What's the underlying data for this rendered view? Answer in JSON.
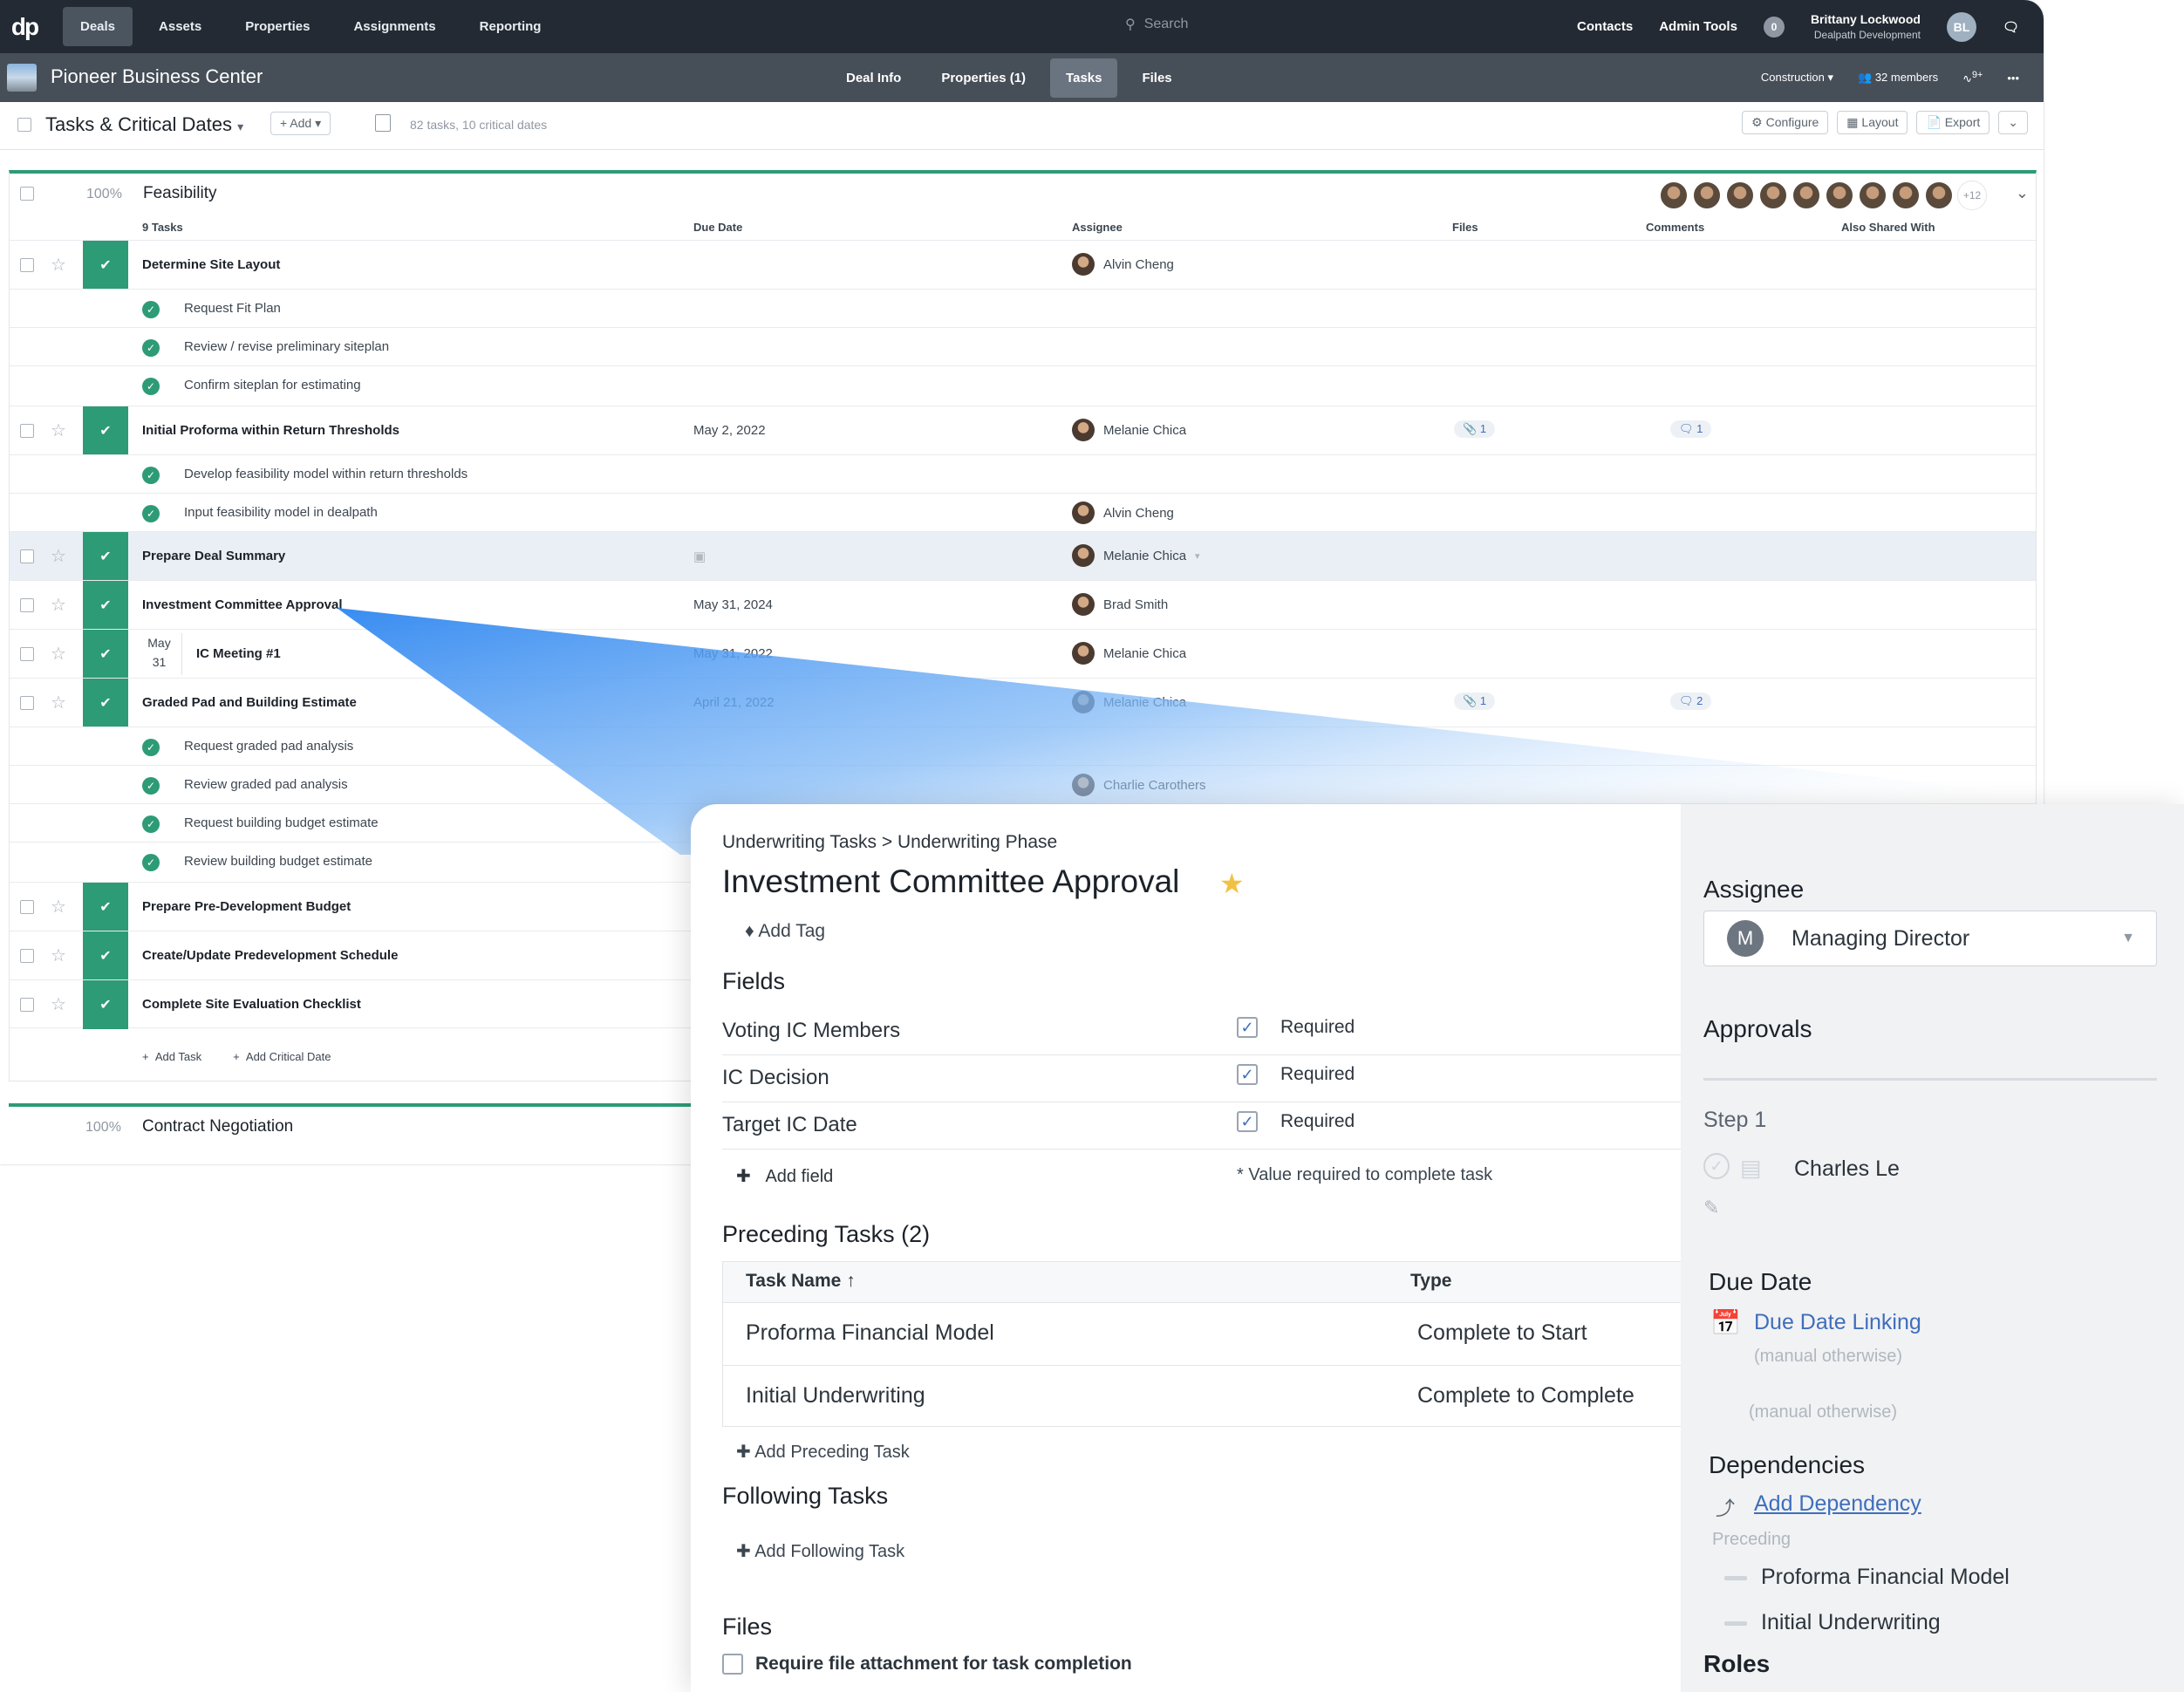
{
  "topnav": {
    "logo": "dp",
    "items": [
      "Deals",
      "Assets",
      "Properties",
      "Assignments",
      "Reporting"
    ],
    "active": "Deals",
    "search_placeholder": "Search",
    "contacts": "Contacts",
    "admin": "Admin Tools",
    "notif_count": "0",
    "user_name": "Brittany Lockwood",
    "user_org": "Dealpath Development",
    "user_initials": "BL"
  },
  "subbar": {
    "deal_title": "Pioneer Business Center",
    "tabs": [
      "Deal Info",
      "Properties (1)",
      "Tasks",
      "Files"
    ],
    "active": "Tasks",
    "stage": "Construction",
    "members": "32 members",
    "activity_badge": "9+"
  },
  "toolbar": {
    "title": "Tasks & Critical Dates",
    "add": "Add",
    "stats": "82 tasks, 10 critical dates",
    "configure": "Configure",
    "layout": "Layout",
    "export": "Export"
  },
  "section": {
    "pct": "100%",
    "name": "Feasibility",
    "faces_more": "+12",
    "cols": {
      "tasks": "9 Tasks",
      "due": "Due Date",
      "assignee": "Assignee",
      "files": "Files",
      "comments": "Comments",
      "shared": "Also Shared With"
    }
  },
  "rows": {
    "r1": {
      "name": "Determine Site Layout",
      "assignee": "Alvin Cheng"
    },
    "r1a": "Request Fit Plan",
    "r1b": "Review / revise preliminary siteplan",
    "r1c": "Confirm siteplan for estimating",
    "r2": {
      "name": "Initial Proforma within Return Thresholds",
      "due": "May 2, 2022",
      "assignee": "Melanie Chica",
      "files": "1",
      "comments": "1"
    },
    "r2a": "Develop feasibility model within return thresholds",
    "r2b": {
      "name": "Input feasibility model in dealpath",
      "assignee": "Alvin Cheng"
    },
    "r3": {
      "name": "Prepare Deal Summary",
      "assignee": "Melanie Chica"
    },
    "r4": {
      "name": "Investment Committee Approval",
      "due": "May 31, 2024",
      "assignee": "Brad Smith"
    },
    "r5": {
      "month": "May",
      "day": "31",
      "name": "IC Meeting #1",
      "due": "May 31, 2022",
      "assignee": "Melanie Chica"
    },
    "r6": {
      "name": "Graded Pad and Building Estimate",
      "due": "April 21, 2022",
      "assignee": "Melanie Chica",
      "files": "1",
      "comments": "2"
    },
    "r6a": "Request graded pad analysis",
    "r6b": {
      "name": "Review graded pad analysis",
      "assignee": "Charlie Carothers"
    },
    "r6c": "Request building budget estimate",
    "r6d": "Review building budget estimate",
    "r7": "Prepare Pre-Development Budget",
    "r8": "Create/Update Predevelopment Schedule",
    "r9": "Complete Site Evaluation Checklist"
  },
  "footer": {
    "add_task": "Add Task",
    "add_date": "Add Critical Date"
  },
  "section2": {
    "pct": "100%",
    "name": "Contract Negotiation"
  },
  "panel": {
    "breadcrumb": "Underwriting Tasks  >  Underwriting Phase",
    "title": "Investment Committee Approval",
    "add_tag": "Add Tag",
    "fields_h": "Fields",
    "fields": [
      {
        "label": "Voting IC Members",
        "req": "Required"
      },
      {
        "label": "IC Decision",
        "req": "Required"
      },
      {
        "label": "Target IC Date",
        "req": "Required"
      }
    ],
    "add_field": "Add field",
    "note": "* Value required to complete task",
    "preceding_h": "Preceding Tasks (2)",
    "th_name": "Task Name",
    "th_type": "Type",
    "preceding": [
      {
        "name": "Proforma Financial Model",
        "type": "Complete to Start"
      },
      {
        "name": "Initial Underwriting",
        "type": "Complete to Complete"
      }
    ],
    "add_preceding": "Add Preceding Task",
    "following_h": "Following Tasks",
    "add_following": "Add Following Task",
    "files_h": "Files",
    "require_file": "Require file attachment for task completion",
    "assignee_h": "Assignee",
    "assignee_initial": "M",
    "assignee": "Managing Director",
    "approvals_h": "Approvals",
    "step": "Step 1",
    "approver": "Charles Le",
    "due_h": "Due Date",
    "due_link": "Due Date Linking",
    "manual1": "(manual otherwise)",
    "manual2": "(manual otherwise)",
    "deps_h": "Dependencies",
    "add_dep": "Add Dependency",
    "preceding_lbl": "Preceding",
    "dep1": "Proforma Financial Model",
    "dep2": "Initial Underwriting",
    "roles_h": "Roles"
  }
}
